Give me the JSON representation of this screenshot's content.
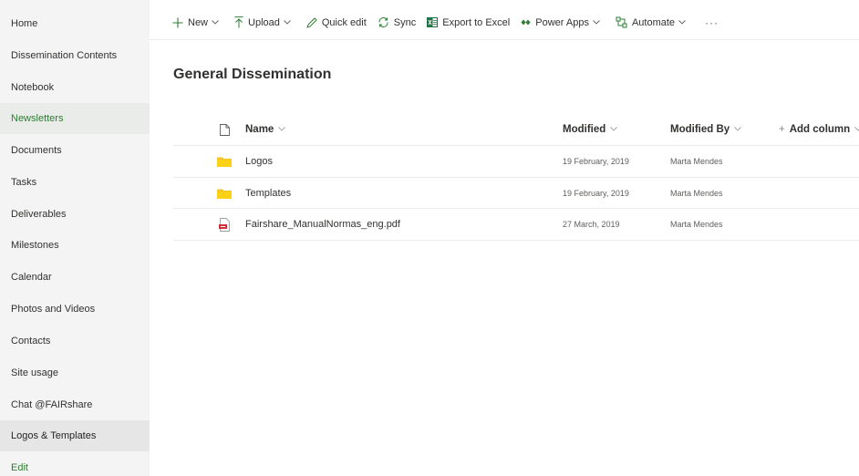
{
  "sidebar": {
    "items": [
      {
        "label": "Home"
      },
      {
        "label": "Dissemination Contents"
      },
      {
        "label": "Notebook"
      },
      {
        "label": "Newsletters"
      },
      {
        "label": "Documents"
      },
      {
        "label": "Tasks"
      },
      {
        "label": "Deliverables"
      },
      {
        "label": "Milestones"
      },
      {
        "label": "Calendar"
      },
      {
        "label": "Photos and Videos"
      },
      {
        "label": "Contacts"
      },
      {
        "label": "Site usage"
      },
      {
        "label": "Chat @FAIRshare"
      },
      {
        "label": "Logos & Templates"
      }
    ],
    "edit_label": "Edit"
  },
  "toolbar": {
    "new_label": "New",
    "upload_label": "Upload",
    "quick_edit_label": "Quick edit",
    "sync_label": "Sync",
    "export_label": "Export to Excel",
    "power_apps_label": "Power Apps",
    "automate_label": "Automate",
    "more_label": "···"
  },
  "library": {
    "title": "General Dissemination",
    "columns": {
      "name": "Name",
      "modified": "Modified",
      "modified_by": "Modified By",
      "add_column": "Add column"
    },
    "rows": [
      {
        "type": "folder",
        "name": "Logos",
        "modified": "19 February, 2019",
        "modified_by": "Marta Mendes"
      },
      {
        "type": "folder",
        "name": "Templates",
        "modified": "19 February, 2019",
        "modified_by": "Marta Mendes"
      },
      {
        "type": "pdf",
        "name": "Fairshare_ManualNormas_eng.pdf",
        "modified": "27 March, 2019",
        "modified_by": "Marta Mendes"
      }
    ]
  },
  "colors": {
    "accent_green": "#2e7d32",
    "folder_yellow": "#f4c430",
    "pdf_red": "#d13438",
    "excel_green": "#217346"
  }
}
